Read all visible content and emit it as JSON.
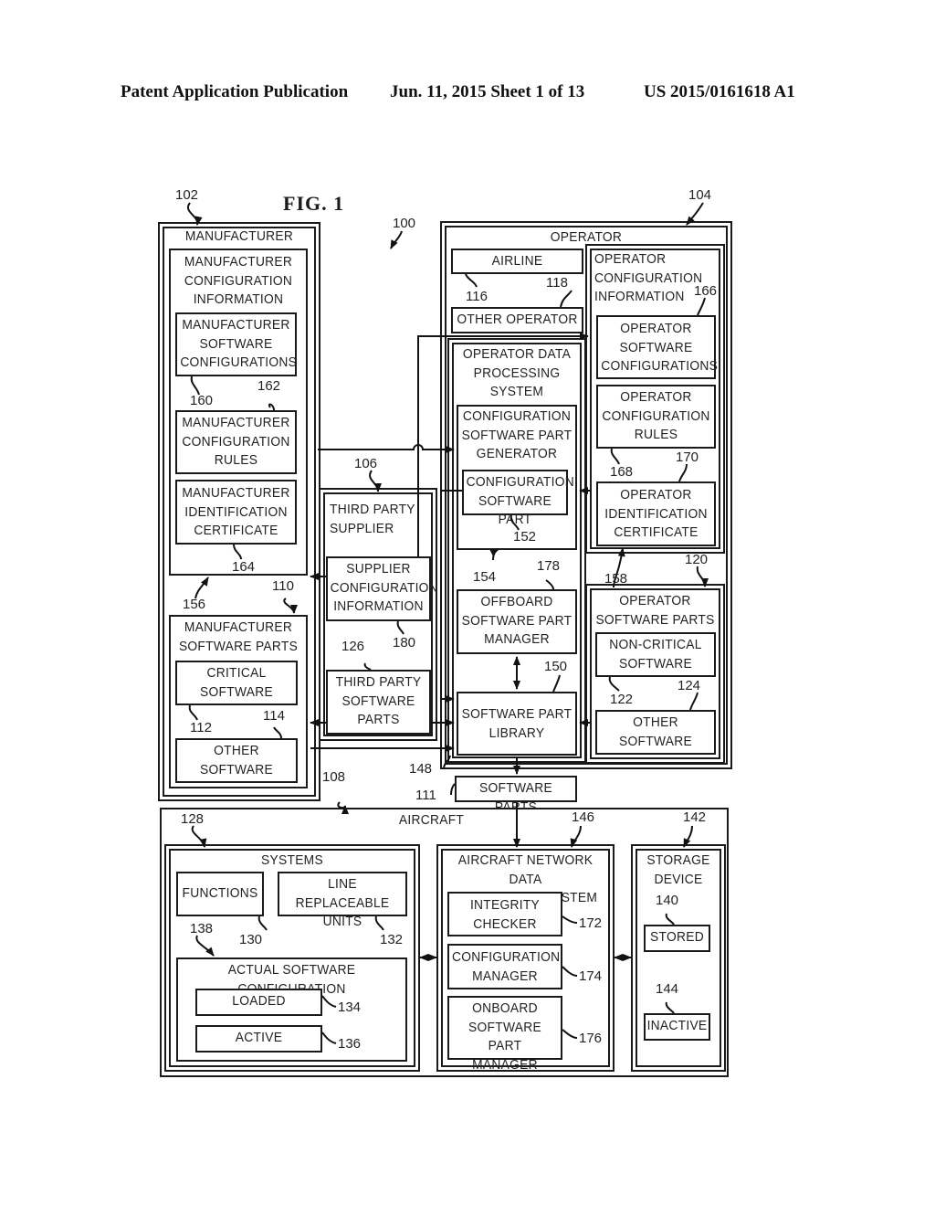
{
  "header": {
    "left": "Patent Application Publication",
    "date_sheet": "Jun. 11, 2015  Sheet 1 of 13",
    "number": "US 2015/0161618 A1"
  },
  "figure": {
    "title": "FIG. 1",
    "system_ref": "100",
    "manufacturer": {
      "ref": "102",
      "label": "MANUFACTURER",
      "config_info": {
        "ref": "156",
        "label": "MANUFACTURER\nCONFIGURATION\nINFORMATION"
      },
      "software_configs": {
        "ref": "160",
        "label": "MANUFACTURER\nSOFTWARE\nCONFIGURATIONS"
      },
      "config_rules": {
        "ref": "162",
        "label": "MANUFACTURER\nCONFIGURATION\nRULES"
      },
      "id_cert": {
        "ref": "164",
        "label": "MANUFACTURER\nIDENTIFICATION\nCERTIFICATE"
      },
      "software_parts": {
        "ref": "110",
        "label": "MANUFACTURER\nSOFTWARE PARTS"
      },
      "critical": {
        "ref": "112",
        "label": "CRITICAL\nSOFTWARE"
      },
      "other": {
        "ref": "114",
        "label": "OTHER\nSOFTWARE"
      }
    },
    "third_party": {
      "ref": "106",
      "label": "THIRD PARTY\nSUPPLIER",
      "config_info": {
        "ref": "180",
        "label": "SUPPLIER\nCONFIGURATION\nINFORMATION"
      },
      "software_parts": {
        "ref": "126",
        "label": "THIRD PARTY\nSOFTWARE\nPARTS"
      }
    },
    "operator": {
      "ref": "104",
      "label": "OPERATOR",
      "airline": {
        "ref": "116",
        "label": "AIRLINE"
      },
      "other_operator": {
        "ref": "118",
        "label": "OTHER OPERATOR"
      },
      "data_processing": {
        "ref": "148",
        "label": "OPERATOR DATA\nPROCESSING\nSYSTEM"
      },
      "generator": {
        "ref": "154",
        "label": "CONFIGURATION\nSOFTWARE PART\nGENERATOR"
      },
      "config_part": {
        "ref": "152",
        "label": "CONFIGURATION\nSOFTWARE PART"
      },
      "offboard": {
        "ref": "178",
        "label": "OFFBOARD\nSOFTWARE PART\nMANAGER"
      },
      "library": {
        "ref": "150",
        "label": "SOFTWARE PART\nLIBRARY"
      },
      "config_info": {
        "ref": "158",
        "label": "OPERATOR\nCONFIGURATION\nINFORMATION"
      },
      "software_configs": {
        "ref": "166",
        "label": "OPERATOR\nSOFTWARE\nCONFIGURATIONS"
      },
      "config_rules": {
        "ref": "168",
        "label": "OPERATOR\nCONFIGURATION\nRULES"
      },
      "id_cert": {
        "ref": "170",
        "label": "OPERATOR\nIDENTIFICATION\nCERTIFICATE"
      },
      "software_parts": {
        "ref": "120",
        "label": "OPERATOR\nSOFTWARE PARTS"
      },
      "non_critical": {
        "ref": "122",
        "label": "NON-CRITICAL\nSOFTWARE"
      },
      "other": {
        "ref": "124",
        "label": "OTHER\nSOFTWARE"
      }
    },
    "software_parts": {
      "ref": "111",
      "label": "SOFTWARE PARTS"
    },
    "aircraft": {
      "ref": "108",
      "label": "AIRCRAFT",
      "systems": {
        "ref": "128",
        "label": "SYSTEMS"
      },
      "functions": {
        "ref": "130",
        "label": "FUNCTIONS"
      },
      "lru": {
        "ref": "132",
        "label": "LINE REPLACEABLE\nUNITS"
      },
      "actual_config": {
        "ref": "138",
        "label": "ACTUAL SOFTWARE CONFIGURATION"
      },
      "loaded": {
        "ref": "134",
        "label": "LOADED"
      },
      "active": {
        "ref": "136",
        "label": "ACTIVE"
      },
      "network": {
        "ref": "146",
        "label": "AIRCRAFT NETWORK DATA\nPROCESSING SYSTEM"
      },
      "integrity": {
        "ref": "172",
        "label": "INTEGRITY\nCHECKER"
      },
      "config_mgr": {
        "ref": "174",
        "label": "CONFIGURATION\nMANAGER"
      },
      "onboard": {
        "ref": "176",
        "label": "ONBOARD\nSOFTWARE PART\nMANAGER"
      },
      "storage": {
        "ref": "142",
        "label": "STORAGE\nDEVICE"
      },
      "stored": {
        "ref": "140",
        "label": "STORED"
      },
      "inactive": {
        "ref": "144",
        "label": "INACTIVE"
      }
    }
  }
}
